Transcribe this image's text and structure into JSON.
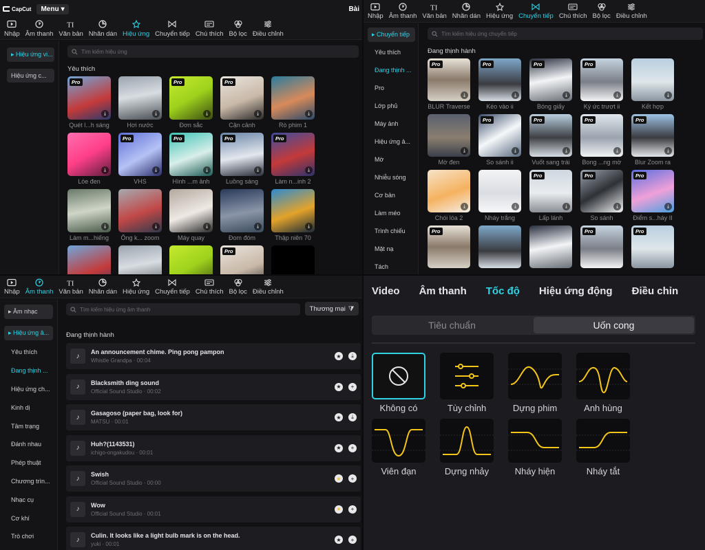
{
  "titlebar": {
    "logo": "CapCut",
    "menu": "Menu",
    "right": "Bài"
  },
  "toolbar": [
    "Nhập",
    "Âm thanh",
    "Văn bản",
    "Nhãn dán",
    "Hiệu ứng",
    "Chuyển tiếp",
    "Chú thích",
    "Bộ lọc",
    "Điều chỉnh"
  ],
  "q1": {
    "active_tool": "Hiệu ứng",
    "sidebar": [
      "Hiệu ứng vi...",
      "Hiệu ứng c..."
    ],
    "search_placeholder": "Tìm kiếm hiệu ứng",
    "section": "Yêu thích",
    "items": [
      {
        "label": "Quét l...h sáng",
        "pro": true
      },
      {
        "label": "Hơi nước",
        "pro": false
      },
      {
        "label": "Đơn sắc",
        "pro": true
      },
      {
        "label": "Cận cảnh",
        "pro": true
      },
      {
        "label": "Rò phim 1",
        "pro": false
      },
      {
        "label": "Lóe đen",
        "pro": false
      },
      {
        "label": "VHS",
        "pro": true
      },
      {
        "label": "Hình ...m ảnh",
        "pro": true
      },
      {
        "label": "Luồng sáng",
        "pro": true
      },
      {
        "label": "Làm n...inh 2",
        "pro": true
      },
      {
        "label": "Làm m...hiếng",
        "pro": false
      },
      {
        "label": "Ống k... zoom",
        "pro": false
      },
      {
        "label": "Máy quay",
        "pro": false
      },
      {
        "label": "Đom đóm",
        "pro": false
      },
      {
        "label": "Thập niên 70",
        "pro": false
      },
      {
        "label": "",
        "pro": false
      },
      {
        "label": "",
        "pro": false
      },
      {
        "label": "",
        "pro": false
      },
      {
        "label": "",
        "pro": true
      },
      {
        "label": "",
        "pro": false
      }
    ]
  },
  "q2": {
    "active_tool": "Chuyển tiếp",
    "sidebar": [
      "Chuyển tiếp",
      "Yêu thích",
      "Đang thịnh ...",
      "Pro",
      "Lớp phủ",
      "Máy ảnh",
      "Hiệu ứng ả...",
      "Mờ",
      "Nhiễu sóng",
      "Cơ bản",
      "Làm méo",
      "Trình chiếu",
      "Mặt nạ",
      "Tách"
    ],
    "search_placeholder": "Tìm kiếm hiệu ứng chuyển tiếp",
    "section": "Đang thịnh hành",
    "items": [
      {
        "label": "BLUR Traverse",
        "pro": true
      },
      {
        "label": "Kéo vào ii",
        "pro": true
      },
      {
        "label": "Bóng giấy",
        "pro": true
      },
      {
        "label": "Ký ức trượt ii",
        "pro": true
      },
      {
        "label": "Kết hợp",
        "pro": false
      },
      {
        "label": "Mờ đen",
        "pro": false
      },
      {
        "label": "So sánh ii",
        "pro": true
      },
      {
        "label": "Vuốt sang trái",
        "pro": true
      },
      {
        "label": "Bong ...ng mờ",
        "pro": true
      },
      {
        "label": "Blur Zoom ra",
        "pro": true
      },
      {
        "label": "Chói lóa 2",
        "pro": false
      },
      {
        "label": "Nháy trắng",
        "pro": false
      },
      {
        "label": "Lấp lánh",
        "pro": true
      },
      {
        "label": "So sánh",
        "pro": true
      },
      {
        "label": "Điểm s...háy II",
        "pro": true
      },
      {
        "label": "",
        "pro": true
      },
      {
        "label": "",
        "pro": false
      },
      {
        "label": "",
        "pro": false
      },
      {
        "label": "",
        "pro": true
      },
      {
        "label": "",
        "pro": true
      }
    ]
  },
  "q3": {
    "active_tool": "Âm thanh",
    "sidebar_buttons": [
      "Âm nhạc",
      "Hiệu ứng â..."
    ],
    "sidebar": [
      "Yêu thích",
      "Đang thịnh ...",
      "Hiệu ứng ch...",
      "Kinh dị",
      "Tâm trạng",
      "Đánh nhau",
      "Phép thuật",
      "Chương trìn...",
      "Nhạc cụ",
      "Cơ khí",
      "Trò chơi"
    ],
    "search_placeholder": "Tìm kiếm hiệu ứng âm thanh",
    "filter": "Thương mại",
    "section": "Đang thịnh hành",
    "tracks": [
      {
        "title": "An announcement chime. Ping pong pampon",
        "meta": "Whistle Grandpa · 00:04",
        "starred": false,
        "action": "download"
      },
      {
        "title": "Blacksmith ding sound",
        "meta": "Official Sound Studio · 00:02",
        "starred": false,
        "action": "add"
      },
      {
        "title": "Gasagoso (paper bag, look for)",
        "meta": "MATSU · 00:01",
        "starred": false,
        "action": "download"
      },
      {
        "title": "Huh?(1143531)",
        "meta": "ichigo-ongakudou · 00:01",
        "starred": false,
        "action": "add"
      },
      {
        "title": "Swish",
        "meta": "Official Sound Studio · 00:00",
        "starred": true,
        "action": "add"
      },
      {
        "title": "Wow",
        "meta": "Official Sound Studio · 00:01",
        "starred": true,
        "action": "add"
      },
      {
        "title": "Culin. It looks like a light bulb mark is on the head.",
        "meta": "yuki · 00:01",
        "starred": false,
        "action": "add"
      }
    ]
  },
  "q4": {
    "tabs": [
      "Video",
      "Âm thanh",
      "Tốc độ",
      "Hiệu ứng động",
      "Điều chỉn"
    ],
    "active_tab": "Tốc độ",
    "segments": [
      "Tiêu chuẩn",
      "Uốn cong"
    ],
    "active_segment": "Uốn cong",
    "presets": [
      {
        "name": "Không có",
        "icon": "none-icon"
      },
      {
        "name": "Tùy chỉnh",
        "icon": "sliders-icon"
      },
      {
        "name": "Dựng phim",
        "icon": "curve-montage-icon"
      },
      {
        "name": "Anh hùng",
        "icon": "curve-hero-icon"
      },
      {
        "name": "Viên đạn",
        "icon": "curve-bullet-icon"
      },
      {
        "name": "Dựng nhảy",
        "icon": "curve-jump-icon"
      },
      {
        "name": "Nháy hiện",
        "icon": "curve-flash-in-icon"
      },
      {
        "name": "Nháy tắt",
        "icon": "curve-flash-out-icon"
      }
    ],
    "curve_color": "#f5c518",
    "accent": "#2fd3e6"
  }
}
